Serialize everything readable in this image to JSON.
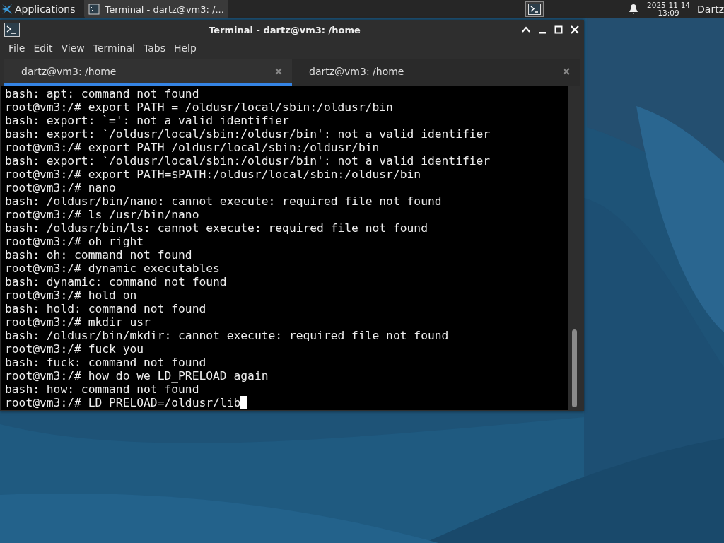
{
  "taskbar": {
    "apps_menu": "Applications",
    "tasks": [
      {
        "title": "Terminal - dartz@vm3: /...",
        "selected": true
      }
    ],
    "clock": {
      "date": "2025-11-14",
      "time": "13:09"
    },
    "user": "Dartz"
  },
  "window": {
    "title": "Terminal - dartz@vm3: /home"
  },
  "menu": [
    "File",
    "Edit",
    "View",
    "Terminal",
    "Tabs",
    "Help"
  ],
  "tabs": [
    {
      "label": "dartz@vm3: /home",
      "selected": true
    },
    {
      "label": "dartz@vm3: /home",
      "selected": false
    }
  ],
  "terminal": {
    "lines": [
      "bash: apt: command not found",
      "root@vm3:/# export PATH = /oldusr/local/sbin:/oldusr/bin",
      "bash: export: `=': not a valid identifier",
      "bash: export: `/oldusr/local/sbin:/oldusr/bin': not a valid identifier",
      "root@vm3:/# export PATH /oldusr/local/sbin:/oldusr/bin",
      "bash: export: `/oldusr/local/sbin:/oldusr/bin': not a valid identifier",
      "root@vm3:/# export PATH=$PATH:/oldusr/local/sbin:/oldusr/bin",
      "root@vm3:/# nano",
      "bash: /oldusr/bin/nano: cannot execute: required file not found",
      "root@vm3:/# ls /usr/bin/nano",
      "bash: /oldusr/bin/ls: cannot execute: required file not found",
      "root@vm3:/# oh right",
      "bash: oh: command not found",
      "root@vm3:/# dynamic executables",
      "bash: dynamic: command not found",
      "root@vm3:/# hold on",
      "bash: hold: command not found",
      "root@vm3:/# mkdir usr",
      "bash: /oldusr/bin/mkdir: cannot execute: required file not found",
      "root@vm3:/# fuck you",
      "bash: fuck: command not found",
      "root@vm3:/# how do we LD_PRELOAD again",
      "bash: how: command not found",
      "root@vm3:/# LD_PRELOAD=/oldusr/lib"
    ]
  }
}
